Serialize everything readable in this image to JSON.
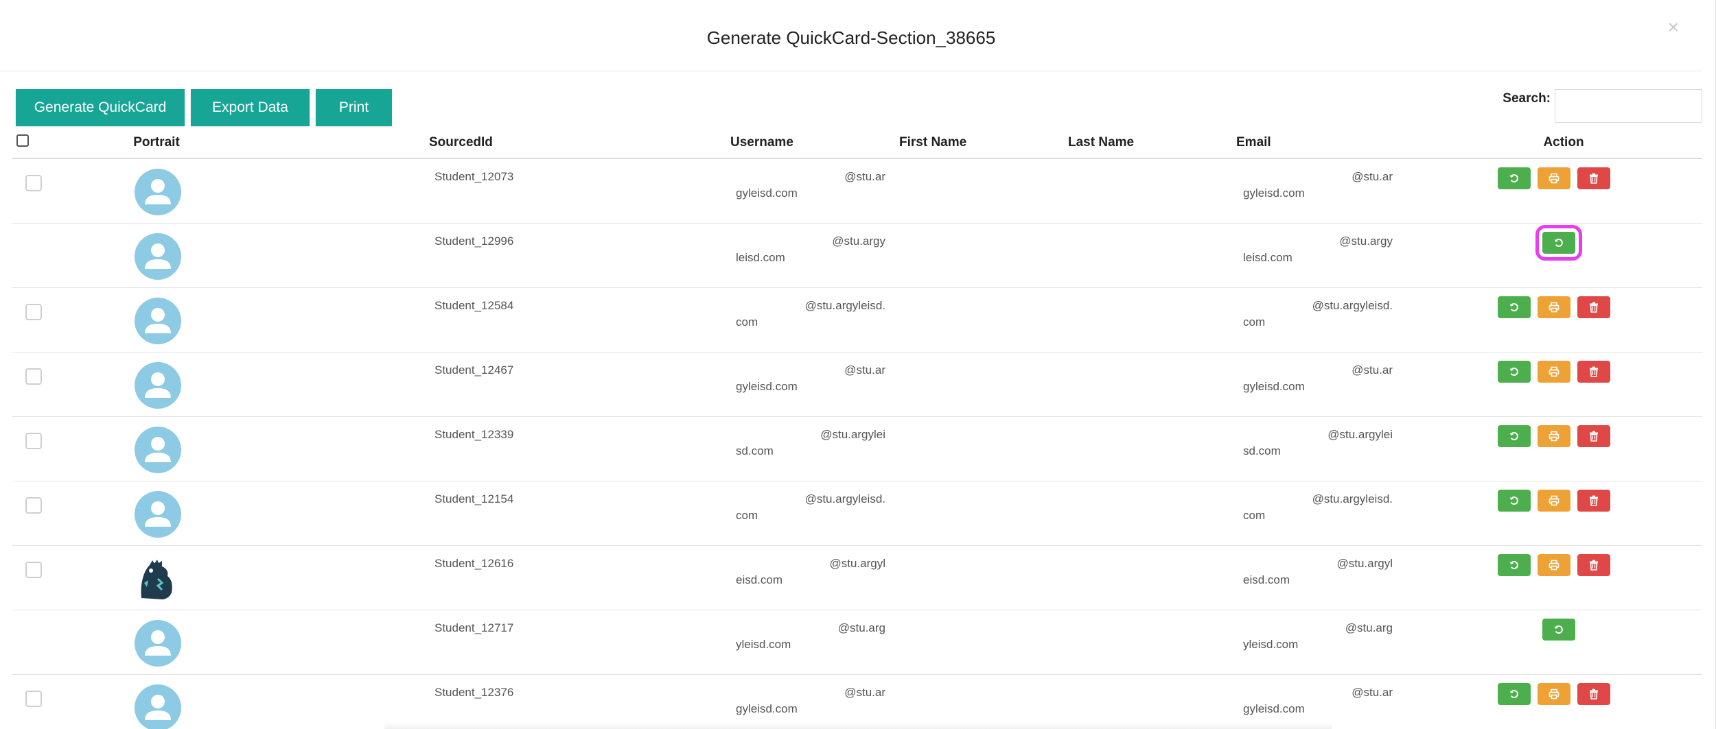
{
  "modal": {
    "title": "Generate QuickCard-Section_38665",
    "close_symbol": "×"
  },
  "toolbar": {
    "generate_label": "Generate QuickCard",
    "export_label": "Export Data",
    "print_label": "Print"
  },
  "search": {
    "label": "Search:",
    "value": "",
    "placeholder": ""
  },
  "table": {
    "headers": {
      "portrait": "Portrait",
      "sourcedid": "SourcedId",
      "username": "Username",
      "firstname": "First Name",
      "lastname": "Last Name",
      "email": "Email",
      "action": "Action"
    },
    "rows": [
      {
        "sourcedid": "Student_12073",
        "username_l1": "@stu.ar",
        "username_l2": "gyleisd.com",
        "email_l1": "@stu.ar",
        "email_l2": "gyleisd.com",
        "actions": "full",
        "checkbox": true,
        "avatar": "default-user"
      },
      {
        "sourcedid": "Student_12996",
        "username_l1": "@stu.argy",
        "username_l2": "leisd.com",
        "email_l1": "@stu.argy",
        "email_l2": "leisd.com",
        "actions": "reset-only",
        "checkbox": false,
        "avatar": "default-user",
        "highlighted_action": "reset"
      },
      {
        "sourcedid": "Student_12584",
        "username_l1": "@stu.argyleisd.",
        "username_l2": "com",
        "email_l1": "@stu.argyleisd.",
        "email_l2": "com",
        "actions": "full",
        "checkbox": true,
        "avatar": "default-user"
      },
      {
        "sourcedid": "Student_12467",
        "username_l1": "@stu.ar",
        "username_l2": "gyleisd.com",
        "email_l1": "@stu.ar",
        "email_l2": "gyleisd.com",
        "actions": "full",
        "checkbox": true,
        "avatar": "default-user"
      },
      {
        "sourcedid": "Student_12339",
        "username_l1": "@stu.argylei",
        "username_l2": "sd.com",
        "email_l1": "@stu.argylei",
        "email_l2": "sd.com",
        "actions": "full",
        "checkbox": true,
        "avatar": "default-user"
      },
      {
        "sourcedid": "Student_12154",
        "username_l1": "@stu.argyleisd.",
        "username_l2": "com",
        "email_l1": "@stu.argyleisd.",
        "email_l2": "com",
        "actions": "full",
        "checkbox": true,
        "avatar": "default-user"
      },
      {
        "sourcedid": "Student_12616",
        "username_l1": "@stu.argyl",
        "username_l2": "eisd.com",
        "email_l1": "@stu.argyl",
        "email_l2": "eisd.com",
        "actions": "full",
        "checkbox": true,
        "avatar": "dinosaur-mascot"
      },
      {
        "sourcedid": "Student_12717",
        "username_l1": "@stu.arg",
        "username_l2": "yleisd.com",
        "email_l1": "@stu.arg",
        "email_l2": "yleisd.com",
        "actions": "reset-only",
        "checkbox": false,
        "avatar": "default-user"
      },
      {
        "sourcedid": "Student_12376",
        "username_l1": "@stu.ar",
        "username_l2": "gyleisd.com",
        "email_l1": "@stu.ar",
        "email_l2": "gyleisd.com",
        "actions": "full",
        "checkbox": true,
        "avatar": "default-user"
      }
    ]
  },
  "colors": {
    "teal": "#17a596",
    "green": "#4cae4c",
    "orange": "#eea236",
    "red": "#e04848",
    "highlight": "#ea3bf0",
    "avatar_bg": "#8ccbe3"
  },
  "icons": {
    "reset": "reset-icon",
    "print": "print-icon",
    "delete": "trash-icon",
    "close": "close-icon"
  }
}
